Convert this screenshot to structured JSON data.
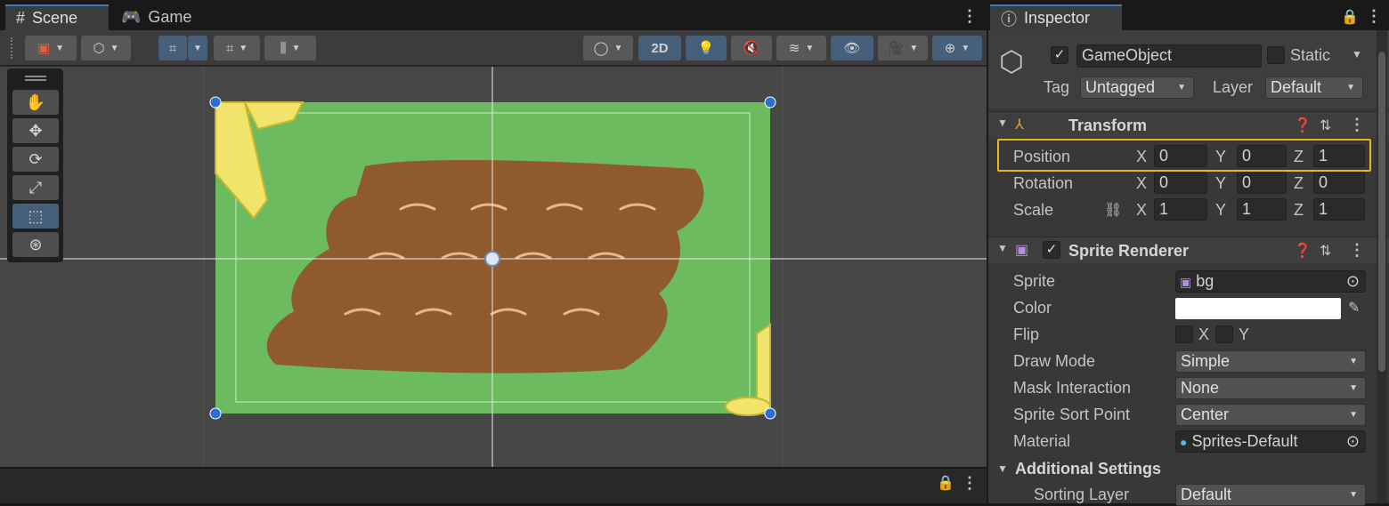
{
  "scene_tabs": [
    {
      "label": "Scene",
      "icon": "grid-icon"
    },
    {
      "label": "Game",
      "icon": "gamepad-icon"
    }
  ],
  "scene_toolbar": {
    "two_d_label": "2D"
  },
  "inspector": {
    "tab_label": "Inspector",
    "object_name": "GameObject",
    "static_label": "Static",
    "tag_label": "Tag",
    "tag_value": "Untagged",
    "layer_label": "Layer",
    "layer_value": "Default",
    "transform": {
      "title": "Transform",
      "position_label": "Position",
      "rotation_label": "Rotation",
      "scale_label": "Scale",
      "x_label": "X",
      "y_label": "Y",
      "z_label": "Z",
      "position": {
        "x": "0",
        "y": "0",
        "z": "1"
      },
      "rotation": {
        "x": "0",
        "y": "0",
        "z": "0"
      },
      "scale": {
        "x": "1",
        "y": "1",
        "z": "1"
      }
    },
    "sprite_renderer": {
      "title": "Sprite Renderer",
      "sprite_label": "Sprite",
      "sprite_value": "bg",
      "color_label": "Color",
      "color_value": "#ffffff",
      "flip_label": "Flip",
      "flip_x": "X",
      "flip_y": "Y",
      "draw_mode_label": "Draw Mode",
      "draw_mode_value": "Simple",
      "mask_label": "Mask Interaction",
      "mask_value": "None",
      "sort_point_label": "Sprite Sort Point",
      "sort_point_value": "Center",
      "material_label": "Material",
      "material_value": "Sprites-Default"
    },
    "additional": {
      "title": "Additional Settings",
      "sorting_layer_label": "Sorting Layer",
      "sorting_layer_value": "Default"
    }
  },
  "colors": {
    "highlight": "#e8b71c",
    "accent": "#3a79bb",
    "grass": "#6cbb5e",
    "dirt": "#8f5a2c"
  }
}
